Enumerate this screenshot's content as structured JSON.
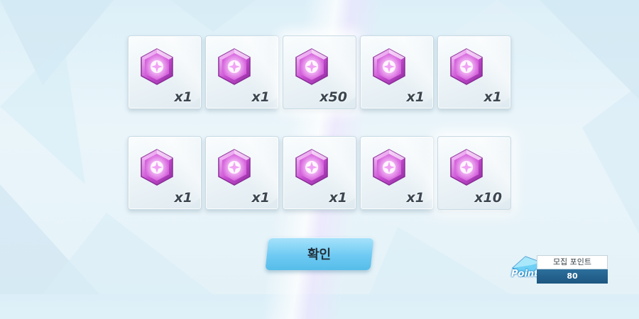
{
  "rewards": [
    {
      "count": "x1",
      "item_icon": "pink-gem-icon",
      "highlighted": false
    },
    {
      "count": "x1",
      "item_icon": "pink-gem-icon",
      "highlighted": false
    },
    {
      "count": "x50",
      "item_icon": "pink-gem-icon",
      "highlighted": true
    },
    {
      "count": "x1",
      "item_icon": "pink-gem-icon",
      "highlighted": false
    },
    {
      "count": "x1",
      "item_icon": "pink-gem-icon",
      "highlighted": false
    },
    {
      "count": "x1",
      "item_icon": "pink-gem-icon",
      "highlighted": false
    },
    {
      "count": "x1",
      "item_icon": "pink-gem-icon",
      "highlighted": false
    },
    {
      "count": "x1",
      "item_icon": "pink-gem-icon",
      "highlighted": false
    },
    {
      "count": "x1",
      "item_icon": "pink-gem-icon",
      "highlighted": false
    },
    {
      "count": "x10",
      "item_icon": "pink-gem-icon",
      "highlighted": true
    }
  ],
  "confirm_button": {
    "label": "확인"
  },
  "recruit_points": {
    "icon_label": "Point",
    "title": "모집 포인트",
    "value": "80"
  },
  "colors": {
    "background": "#e4f2f8",
    "gem": "#e07ae8",
    "button": "#6fcaf3",
    "points_bar": "#1d5680"
  }
}
